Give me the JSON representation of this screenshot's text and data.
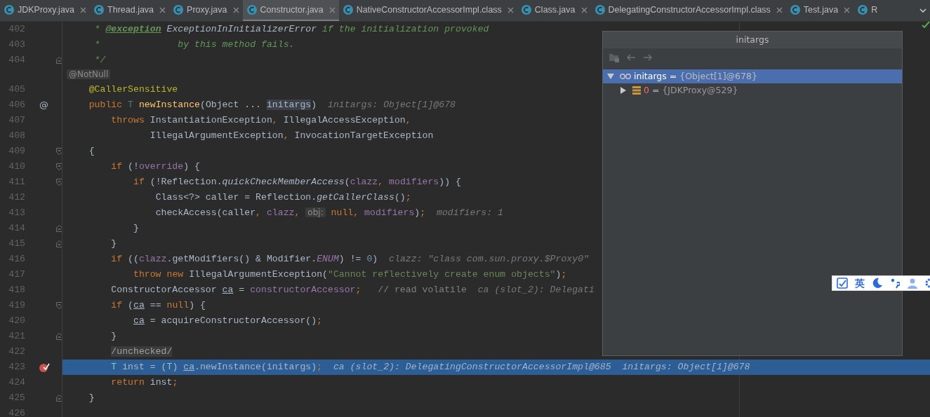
{
  "tabs": [
    {
      "label": "JDKProxy.java",
      "selected": false,
      "closable": true
    },
    {
      "label": "Thread.java",
      "selected": false,
      "closable": true
    },
    {
      "label": "Proxy.java",
      "selected": false,
      "closable": true
    },
    {
      "label": "Constructor.java",
      "selected": true,
      "closable": true
    },
    {
      "label": "NativeConstructorAccessorImpl.class",
      "selected": false,
      "closable": true
    },
    {
      "label": "Class.java",
      "selected": false,
      "closable": true
    },
    {
      "label": "DelegatingConstructorAccessorImpl.class",
      "selected": false,
      "closable": true
    },
    {
      "label": "Test.java",
      "selected": false,
      "closable": true
    },
    {
      "label": "R",
      "selected": false,
      "closable": false
    }
  ],
  "editor": {
    "lines": [
      {
        "kind": "code",
        "number": "402",
        "tokens": [
          {
            "text": "     * ",
            "kind": "doc"
          },
          {
            "text": "@exception",
            "kind": "doctag"
          },
          {
            "text": " ExceptionInInitializerError",
            "kind": "docref"
          },
          {
            "text": " if the initialization provoked",
            "kind": "doc"
          }
        ]
      },
      {
        "kind": "code",
        "number": "403",
        "tokens": [
          {
            "text": "     *              by this method fails.",
            "kind": "doc"
          }
        ]
      },
      {
        "kind": "code",
        "number": "404",
        "fold_end": true,
        "tokens": [
          {
            "text": "     */",
            "kind": "doc"
          }
        ]
      },
      {
        "kind": "inlay",
        "tokens": [
          {
            "text": "@NotNull",
            "kind": "inlay"
          }
        ]
      },
      {
        "kind": "code",
        "number": "405",
        "tokens": [
          {
            "text": "    @CallerSensitive",
            "kind": "annotation"
          }
        ]
      },
      {
        "kind": "code",
        "number": "406",
        "gutter_symbol": "@",
        "tokens": [
          {
            "text": "    public",
            "kind": "keyword"
          },
          {
            "text": " T",
            "kind": "typeparam"
          },
          {
            "text": " newInstance",
            "kind": "methoddecl"
          },
          {
            "text": "(Object ... ",
            "kind": "plain"
          },
          {
            "text": "initargs",
            "kind": "usage"
          },
          {
            "text": ")",
            "kind": "plain"
          },
          {
            "text": "  initargs: Object[1]@678",
            "kind": "hint"
          }
        ]
      },
      {
        "kind": "code",
        "number": "407",
        "tokens": [
          {
            "text": "        throws",
            "kind": "keyword"
          },
          {
            "text": " InstantiationException",
            "kind": "plain"
          },
          {
            "text": ",",
            "kind": "punct"
          },
          {
            "text": " IllegalAccessException",
            "kind": "plain"
          },
          {
            "text": ",",
            "kind": "punct"
          }
        ]
      },
      {
        "kind": "code",
        "number": "408",
        "tokens": [
          {
            "text": "               IllegalArgumentException",
            "kind": "plain"
          },
          {
            "text": ",",
            "kind": "punct"
          },
          {
            "text": " InvocationTargetException",
            "kind": "plain"
          }
        ]
      },
      {
        "kind": "code",
        "number": "409",
        "fold_start": true,
        "tokens": [
          {
            "text": "    {",
            "kind": "plain"
          }
        ]
      },
      {
        "kind": "code",
        "number": "410",
        "fold_start": true,
        "tokens": [
          {
            "text": "        if",
            "kind": "keyword"
          },
          {
            "text": " (!",
            "kind": "plain"
          },
          {
            "text": "override",
            "kind": "field"
          },
          {
            "text": ") {",
            "kind": "plain"
          }
        ]
      },
      {
        "kind": "code",
        "number": "411",
        "fold_start": true,
        "tokens": [
          {
            "text": "            if",
            "kind": "keyword"
          },
          {
            "text": " (!Reflection.",
            "kind": "plain"
          },
          {
            "text": "quickCheckMemberAccess",
            "kind": "static"
          },
          {
            "text": "(",
            "kind": "plain"
          },
          {
            "text": "clazz",
            "kind": "field"
          },
          {
            "text": ",",
            "kind": "punct"
          },
          {
            "text": " modifiers",
            "kind": "field"
          },
          {
            "text": ")) {",
            "kind": "plain"
          }
        ]
      },
      {
        "kind": "code",
        "number": "412",
        "tokens": [
          {
            "text": "                Class<?> caller = Reflection.",
            "kind": "plain"
          },
          {
            "text": "getCallerClass",
            "kind": "static"
          },
          {
            "text": "()",
            "kind": "plain"
          },
          {
            "text": ";",
            "kind": "punct"
          }
        ]
      },
      {
        "kind": "code",
        "number": "413",
        "tokens": [
          {
            "text": "                checkAccess(caller",
            "kind": "plain"
          },
          {
            "text": ",",
            "kind": "punct"
          },
          {
            "text": " clazz",
            "kind": "field"
          },
          {
            "text": ",",
            "kind": "punct"
          },
          {
            "text": " obj:",
            "kind": "inlay"
          },
          {
            "text": " null",
            "kind": "keyword"
          },
          {
            "text": ",",
            "kind": "punct"
          },
          {
            "text": " modifiers",
            "kind": "field"
          },
          {
            "text": ")",
            "kind": "plain"
          },
          {
            "text": ";",
            "kind": "punct"
          },
          {
            "text": "  modifiers: 1",
            "kind": "hint"
          }
        ]
      },
      {
        "kind": "code",
        "number": "414",
        "fold_end": true,
        "tokens": [
          {
            "text": "            }",
            "kind": "plain"
          }
        ]
      },
      {
        "kind": "code",
        "number": "415",
        "fold_end": true,
        "tokens": [
          {
            "text": "        }",
            "kind": "plain"
          }
        ]
      },
      {
        "kind": "code",
        "number": "416",
        "tokens": [
          {
            "text": "        if",
            "kind": "keyword"
          },
          {
            "text": " ((",
            "kind": "plain"
          },
          {
            "text": "clazz",
            "kind": "field"
          },
          {
            "text": ".getModifiers() & Modifier.",
            "kind": "plain"
          },
          {
            "text": "ENUM",
            "kind": "staticfield"
          },
          {
            "text": ") != ",
            "kind": "plain"
          },
          {
            "text": "0",
            "kind": "number"
          },
          {
            "text": ")",
            "kind": "plain"
          },
          {
            "text": "  clazz: \"class com.sun.proxy.$Proxy0\"",
            "kind": "hint"
          }
        ]
      },
      {
        "kind": "code",
        "number": "417",
        "tokens": [
          {
            "text": "            throw",
            "kind": "keyword"
          },
          {
            "text": " new",
            "kind": "keyword"
          },
          {
            "text": " IllegalArgumentException(",
            "kind": "plain"
          },
          {
            "text": "\"Cannot reflectively create enum objects\"",
            "kind": "string"
          },
          {
            "text": ")",
            "kind": "plain"
          },
          {
            "text": ";",
            "kind": "punct"
          }
        ]
      },
      {
        "kind": "code",
        "number": "418",
        "tokens": [
          {
            "text": "        ConstructorAccessor ",
            "kind": "plain"
          },
          {
            "text": "ca",
            "kind": "local"
          },
          {
            "text": " = ",
            "kind": "plain"
          },
          {
            "text": "constructorAccessor",
            "kind": "field"
          },
          {
            "text": ";",
            "kind": "punct"
          },
          {
            "text": "   // read volatile",
            "kind": "comment"
          },
          {
            "text": "  ca (slot_2): Delegati",
            "kind": "hint"
          }
        ]
      },
      {
        "kind": "code",
        "number": "419",
        "fold_start": true,
        "tokens": [
          {
            "text": "        if",
            "kind": "keyword"
          },
          {
            "text": " (",
            "kind": "plain"
          },
          {
            "text": "ca",
            "kind": "local"
          },
          {
            "text": " == ",
            "kind": "plain"
          },
          {
            "text": "null",
            "kind": "keyword"
          },
          {
            "text": ") {",
            "kind": "plain"
          }
        ]
      },
      {
        "kind": "code",
        "number": "420",
        "tokens": [
          {
            "text": "            ca",
            "kind": "local"
          },
          {
            "text": " = acquireConstructorAccessor()",
            "kind": "plain"
          },
          {
            "text": ";",
            "kind": "punct"
          }
        ]
      },
      {
        "kind": "code",
        "number": "421",
        "fold_end": true,
        "tokens": [
          {
            "text": "        }",
            "kind": "plain"
          }
        ]
      },
      {
        "kind": "code",
        "number": "422",
        "tokens": [
          {
            "text": "        /unchecked/",
            "kind": "folded"
          }
        ]
      },
      {
        "kind": "code",
        "number": "423",
        "breakpoint": true,
        "highlighted": true,
        "tokens": [
          {
            "text": "        T",
            "kind": "typeparam"
          },
          {
            "text": " inst = (",
            "kind": "plain"
          },
          {
            "text": "T",
            "kind": "typeparam"
          },
          {
            "text": ") ",
            "kind": "plain"
          },
          {
            "text": "ca",
            "kind": "local"
          },
          {
            "text": ".newInstance(initargs)",
            "kind": "plain"
          },
          {
            "text": ";",
            "kind": "punct"
          },
          {
            "text": "  ca (slot_2): DelegatingConstructorAccessorImpl@685  initargs: Object[1]@678",
            "kind": "hint"
          }
        ]
      },
      {
        "kind": "code",
        "number": "424",
        "tokens": [
          {
            "text": "        return",
            "kind": "keyword"
          },
          {
            "text": " inst",
            "kind": "plain"
          },
          {
            "text": ";",
            "kind": "punct"
          }
        ]
      },
      {
        "kind": "code",
        "number": "425",
        "fold_end": true,
        "tokens": [
          {
            "text": "    }",
            "kind": "plain"
          }
        ]
      },
      {
        "kind": "code",
        "number": "426"
      }
    ]
  },
  "popup": {
    "title": "initargs",
    "tree": [
      {
        "kind": "variable",
        "name": "initargs",
        "operator": "=",
        "value": "{Object[1]@678}",
        "expanded": true,
        "selected": true,
        "children": [
          {
            "kind": "array_element",
            "name": "0",
            "operator": "=",
            "value": "{JDKProxy@529}",
            "expanded": false,
            "selected": false
          }
        ]
      }
    ]
  },
  "ime_toolbar": {
    "language": "英"
  }
}
